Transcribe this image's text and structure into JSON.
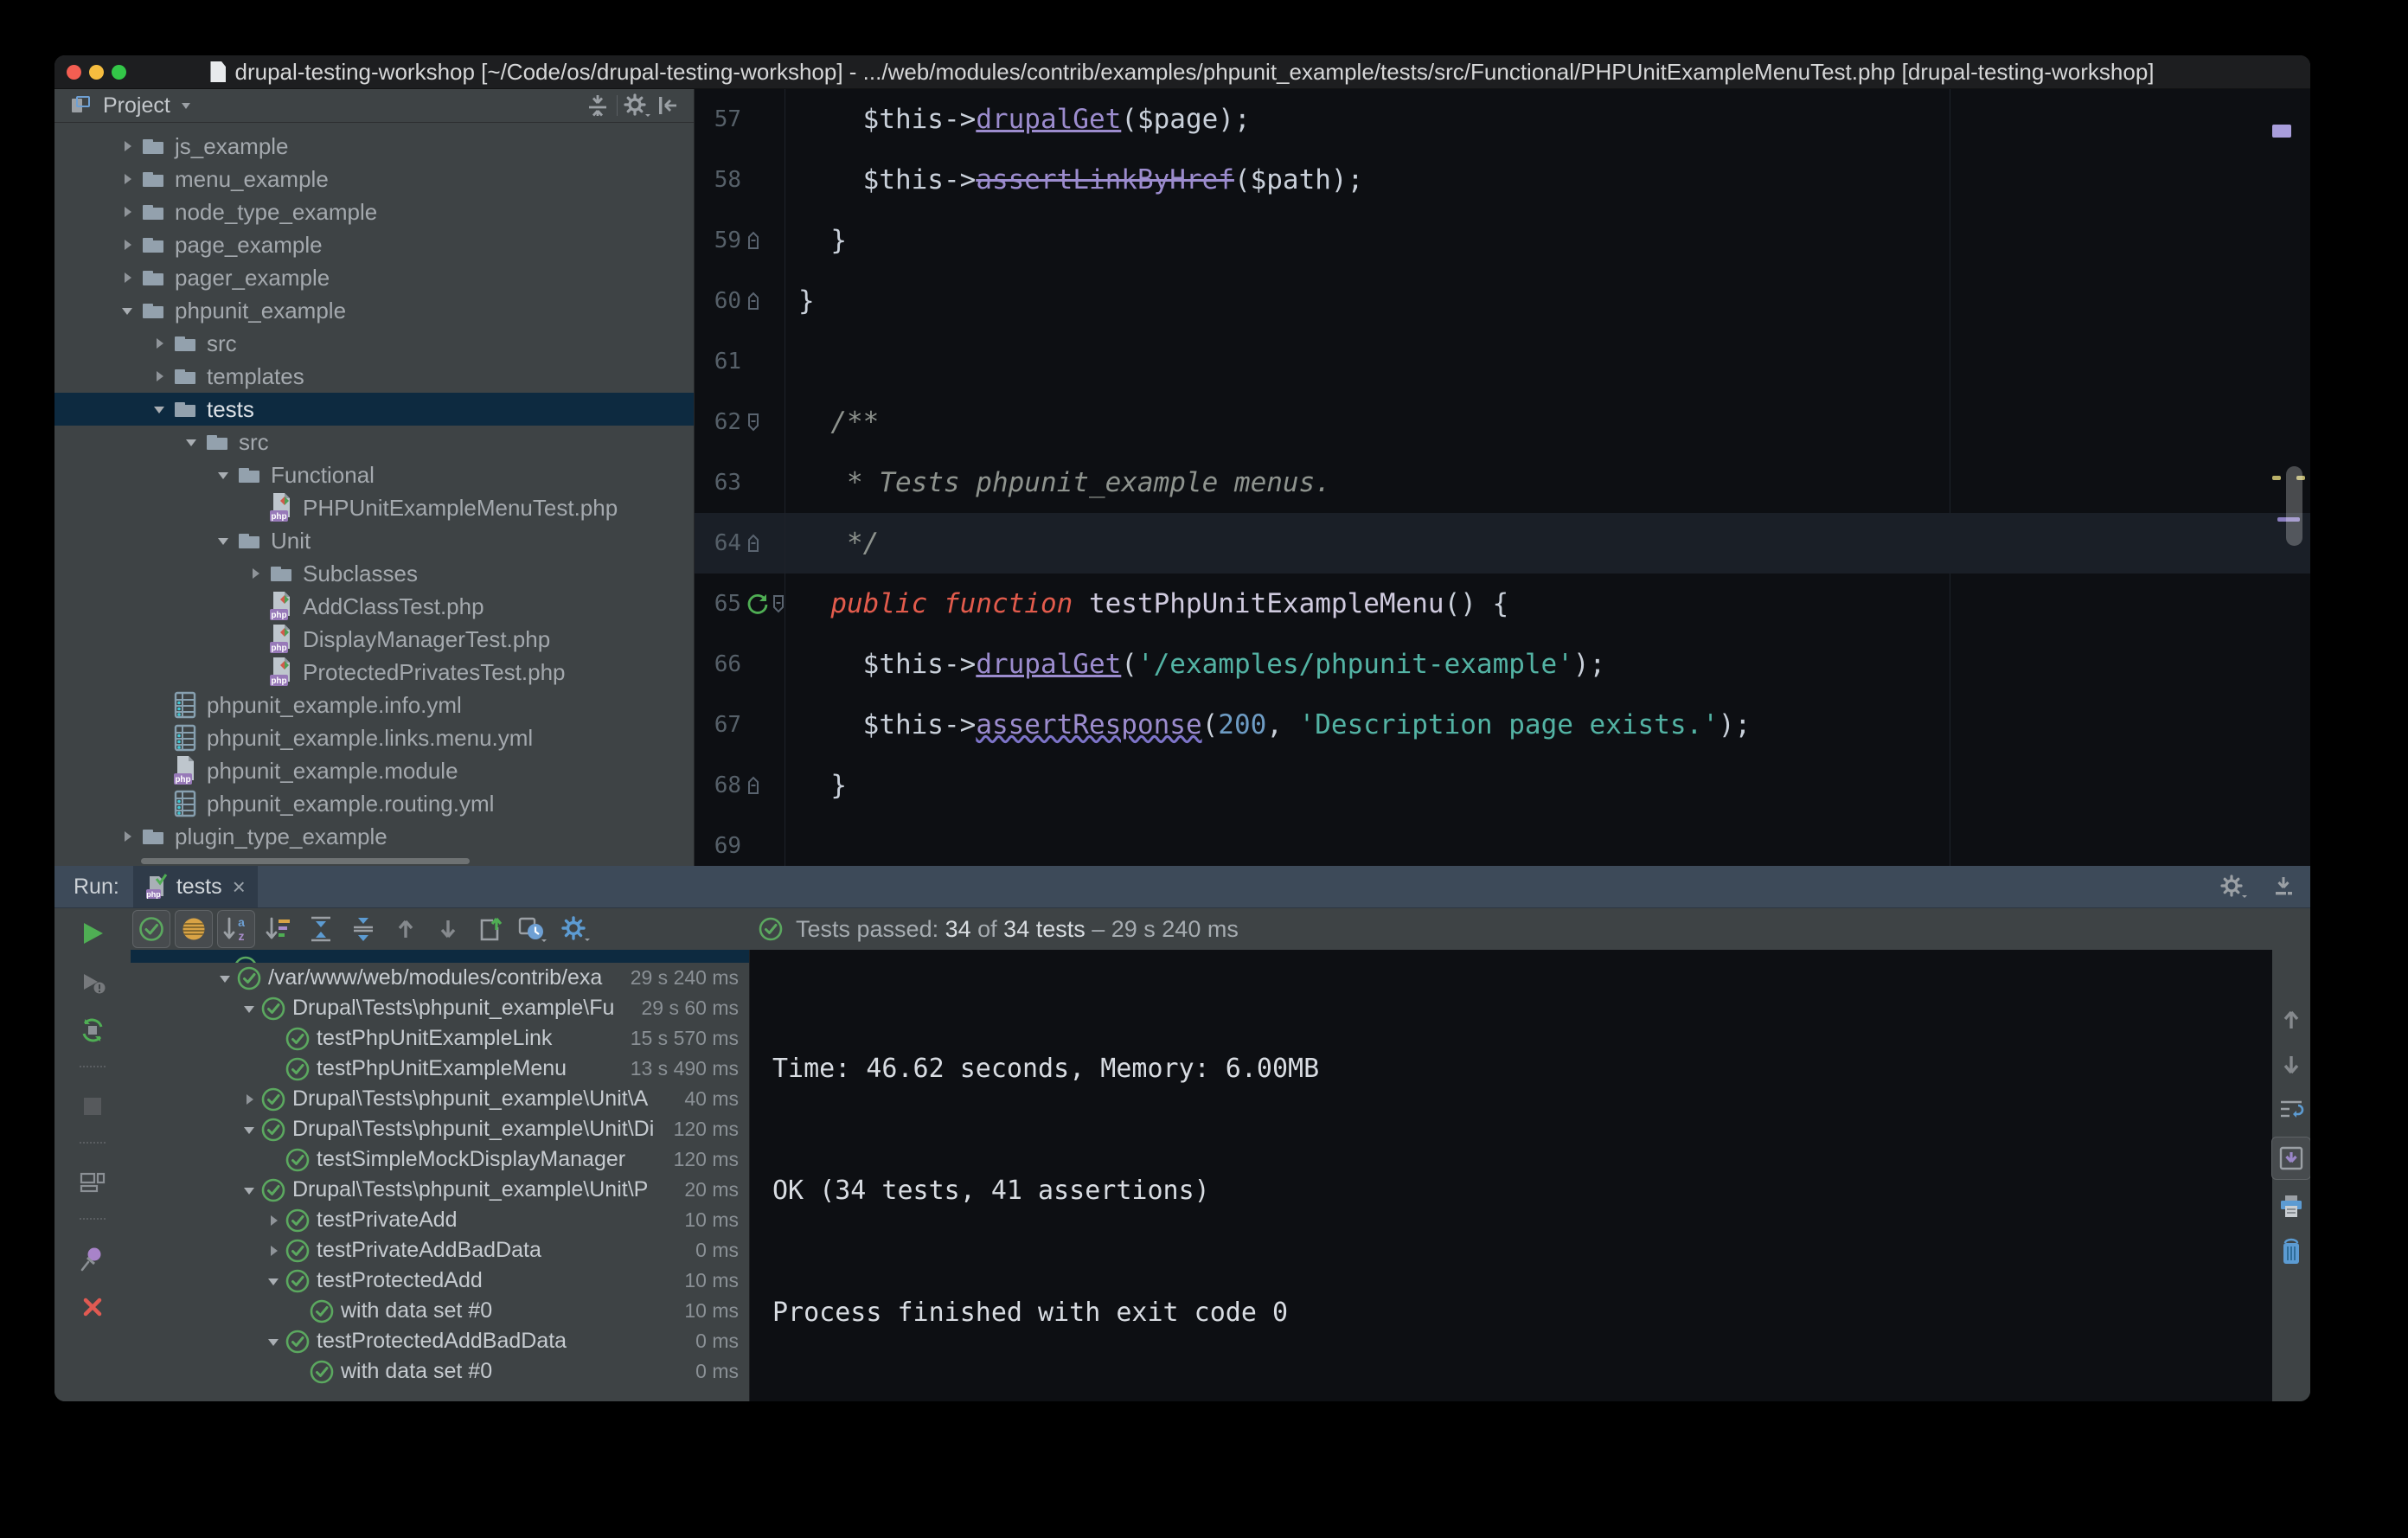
{
  "window": {
    "title": "drupal-testing-workshop [~/Code/os/drupal-testing-workshop] - .../web/modules/contrib/examples/phpunit_example/tests/src/Functional/PHPUnitExampleMenuTest.php [drupal-testing-workshop]"
  },
  "colors": {
    "selection_blue": "#0d2a40",
    "pass_green": "#5ba85f",
    "accent_blue": "#5c9bd2",
    "keyword_red": "#e25b4c",
    "string_teal": "#53b3a4",
    "method_purple": "#9c8cce"
  },
  "project_panel": {
    "header": {
      "title": "Project",
      "icons": [
        "locate",
        "sep",
        "gear-gray",
        "hide-left"
      ]
    },
    "tree": [
      {
        "label": "js_example",
        "level": 1,
        "icon": "folder",
        "arrow": "collapsed"
      },
      {
        "label": "menu_example",
        "level": 1,
        "icon": "folder",
        "arrow": "collapsed"
      },
      {
        "label": "node_type_example",
        "level": 1,
        "icon": "folder",
        "arrow": "collapsed"
      },
      {
        "label": "page_example",
        "level": 1,
        "icon": "folder",
        "arrow": "collapsed"
      },
      {
        "label": "pager_example",
        "level": 1,
        "icon": "folder",
        "arrow": "collapsed"
      },
      {
        "label": "phpunit_example",
        "level": 1,
        "icon": "folder",
        "arrow": "expanded"
      },
      {
        "label": "src",
        "level": 2,
        "icon": "folder",
        "arrow": "collapsed"
      },
      {
        "label": "templates",
        "level": 2,
        "icon": "folder",
        "arrow": "collapsed"
      },
      {
        "label": "tests",
        "level": 2,
        "icon": "folder",
        "arrow": "expanded",
        "selected": true
      },
      {
        "label": "src",
        "level": 3,
        "icon": "folder",
        "arrow": "expanded"
      },
      {
        "label": "Functional",
        "level": 4,
        "icon": "folder",
        "arrow": "expanded"
      },
      {
        "label": "PHPUnitExampleMenuTest.php",
        "level": 5,
        "icon": "php-file",
        "arrow": "none"
      },
      {
        "label": "Unit",
        "level": 4,
        "icon": "folder",
        "arrow": "expanded"
      },
      {
        "label": "Subclasses",
        "level": 5,
        "icon": "folder",
        "arrow": "collapsed"
      },
      {
        "label": "AddClassTest.php",
        "level": 5,
        "icon": "php-file",
        "arrow": "none"
      },
      {
        "label": "DisplayManagerTest.php",
        "level": 5,
        "icon": "php-file",
        "arrow": "none"
      },
      {
        "label": "ProtectedPrivatesTest.php",
        "level": 5,
        "icon": "php-file",
        "arrow": "none"
      },
      {
        "label": "phpunit_example.info.yml",
        "level": 2,
        "icon": "yml-file",
        "arrow": "none"
      },
      {
        "label": "phpunit_example.links.menu.yml",
        "level": 2,
        "icon": "yml-file",
        "arrow": "none"
      },
      {
        "label": "phpunit_example.module",
        "level": 2,
        "icon": "module-file",
        "arrow": "none"
      },
      {
        "label": "phpunit_example.routing.yml",
        "level": 2,
        "icon": "yml-file",
        "arrow": "none"
      },
      {
        "label": "plugin_type_example",
        "level": 1,
        "icon": "folder",
        "arrow": "collapsed"
      }
    ]
  },
  "editor": {
    "caret_line": 64,
    "lines": [
      {
        "num": "57",
        "gutter": [],
        "tokens": [
          [
            "ws",
            "    "
          ],
          [
            "plain",
            "$this->"
          ],
          [
            "method",
            "drupalGet"
          ],
          [
            "plain",
            "($page);"
          ]
        ]
      },
      {
        "num": "58",
        "gutter": [],
        "tokens": [
          [
            "ws",
            "    "
          ],
          [
            "plain",
            "$this->"
          ],
          [
            "deprecated",
            "assertLinkByHref"
          ],
          [
            "plain",
            "($path);"
          ]
        ]
      },
      {
        "num": "59",
        "gutter": [
          "fold-end"
        ],
        "tokens": [
          [
            "ws",
            "  "
          ],
          [
            "plain",
            "}"
          ]
        ]
      },
      {
        "num": "60",
        "gutter": [
          "fold-end"
        ],
        "tokens": [
          [
            "plain",
            "}"
          ]
        ]
      },
      {
        "num": "61",
        "gutter": [],
        "tokens": []
      },
      {
        "num": "62",
        "gutter": [
          "fold-start"
        ],
        "tokens": [
          [
            "ws",
            "  "
          ],
          [
            "doc",
            "/**"
          ]
        ]
      },
      {
        "num": "63",
        "gutter": [],
        "tokens": [
          [
            "ws",
            "  "
          ],
          [
            "doc",
            " * Tests phpunit_example menus."
          ]
        ]
      },
      {
        "num": "64",
        "gutter": [
          "fold-end"
        ],
        "tokens": [
          [
            "ws",
            "  "
          ],
          [
            "doc",
            " */"
          ]
        ]
      },
      {
        "num": "65",
        "gutter": [
          "run-test",
          "fold-start"
        ],
        "tokens": [
          [
            "ws",
            "  "
          ],
          [
            "kw",
            "public function "
          ],
          [
            "decl",
            "testPhpUnitExampleMenu"
          ],
          [
            "plain",
            "() {"
          ]
        ]
      },
      {
        "num": "66",
        "gutter": [],
        "tokens": [
          [
            "ws",
            "    "
          ],
          [
            "plain",
            "$this->"
          ],
          [
            "method",
            "drupalGet"
          ],
          [
            "plain",
            "("
          ],
          [
            "str",
            "'/examples/phpunit-example'"
          ],
          [
            "plain",
            ");"
          ]
        ]
      },
      {
        "num": "67",
        "gutter": [],
        "tokens": [
          [
            "ws",
            "    "
          ],
          [
            "plain",
            "$this->"
          ],
          [
            "warnmethod",
            "assertResponse"
          ],
          [
            "plain",
            "("
          ],
          [
            "num",
            "200"
          ],
          [
            "plain",
            ", "
          ],
          [
            "str",
            "'Description page exists.'"
          ],
          [
            "plain",
            ");"
          ]
        ]
      },
      {
        "num": "68",
        "gutter": [
          "fold-end"
        ],
        "tokens": [
          [
            "ws",
            "  "
          ],
          [
            "plain",
            "}"
          ]
        ]
      },
      {
        "num": "69",
        "gutter": [],
        "tokens": []
      }
    ]
  },
  "run_panel": {
    "label": "Run:",
    "tab": {
      "icon": "php-test",
      "label": "tests",
      "close": "×"
    },
    "header_icons": [
      "gear-gray",
      "hide-down"
    ],
    "left_toolbar": [
      "play",
      "rerun-failed",
      "auto-rerun",
      "sep",
      "stop",
      "sep",
      "layout",
      "sep",
      "pin",
      "close-x"
    ],
    "toolbar": [
      {
        "icon": "filter-pass",
        "pressed": true
      },
      {
        "icon": "filter-ignored",
        "pressed": true
      },
      {
        "icon": "sort-az",
        "pressed": true
      },
      {
        "icon": "sort-duration",
        "pressed": false
      },
      {
        "icon": "expand-all",
        "pressed": false
      },
      {
        "icon": "collapse-all",
        "pressed": false
      },
      {
        "icon": "arrow-up",
        "pressed": false
      },
      {
        "icon": "arrow-down",
        "pressed": false
      },
      {
        "icon": "import-results",
        "pressed": false
      },
      {
        "icon": "history-clock",
        "pressed": false
      },
      {
        "icon": "gear-blue",
        "pressed": false
      }
    ],
    "status": {
      "icon": "check-circle",
      "parts": [
        {
          "text": "Tests passed: ",
          "style": "muted"
        },
        {
          "text": "34",
          "style": "bright"
        },
        {
          "text": " of ",
          "style": "muted"
        },
        {
          "text": "34 tests",
          "style": "bright"
        },
        {
          "text": " – 29 s 240 ms",
          "style": "muted"
        }
      ]
    },
    "test_tree": [
      {
        "label": "/var/www/web/modules/contrib/exa",
        "duration": "29 s 240 ms",
        "level": 0,
        "arrow": "expanded"
      },
      {
        "label": "Drupal\\Tests\\phpunit_example\\Fu",
        "duration": "29 s 60 ms",
        "level": 1,
        "arrow": "expanded"
      },
      {
        "label": "testPhpUnitExampleLink",
        "duration": "15 s 570 ms",
        "level": 2,
        "arrow": "none"
      },
      {
        "label": "testPhpUnitExampleMenu",
        "duration": "13 s 490 ms",
        "level": 2,
        "arrow": "none"
      },
      {
        "label": "Drupal\\Tests\\phpunit_example\\Unit\\A",
        "duration": "40 ms",
        "level": 1,
        "arrow": "collapsed"
      },
      {
        "label": "Drupal\\Tests\\phpunit_example\\Unit\\Di",
        "duration": "120 ms",
        "level": 1,
        "arrow": "expanded"
      },
      {
        "label": "testSimpleMockDisplayManager",
        "duration": "120 ms",
        "level": 2,
        "arrow": "none"
      },
      {
        "label": "Drupal\\Tests\\phpunit_example\\Unit\\P",
        "duration": "20 ms",
        "level": 1,
        "arrow": "expanded"
      },
      {
        "label": "testPrivateAdd",
        "duration": "10 ms",
        "level": 2,
        "arrow": "collapsed"
      },
      {
        "label": "testPrivateAddBadData",
        "duration": "0 ms",
        "level": 2,
        "arrow": "collapsed"
      },
      {
        "label": "testProtectedAdd",
        "duration": "10 ms",
        "level": 2,
        "arrow": "expanded"
      },
      {
        "label": "with data set #0",
        "duration": "10 ms",
        "level": 3,
        "arrow": "none"
      },
      {
        "label": "testProtectedAddBadData",
        "duration": "0 ms",
        "level": 2,
        "arrow": "expanded"
      },
      {
        "label": "with data set #0",
        "duration": "0 ms",
        "level": 3,
        "arrow": "none"
      }
    ],
    "console_lines": [
      "",
      "Time: 46.62 seconds, Memory: 6.00MB",
      "",
      "",
      "OK (34 tests, 41 assertions)",
      "",
      "",
      "Process finished with exit code 0"
    ],
    "right_toolbar": [
      {
        "icon": "arrow-up",
        "pressed": false
      },
      {
        "icon": "arrow-down",
        "pressed": false
      },
      {
        "icon": "softwrap",
        "pressed": false
      },
      {
        "icon": "scroll-end",
        "pressed": true
      },
      {
        "icon": "printer",
        "pressed": false
      },
      {
        "icon": "trash",
        "pressed": false
      }
    ]
  }
}
